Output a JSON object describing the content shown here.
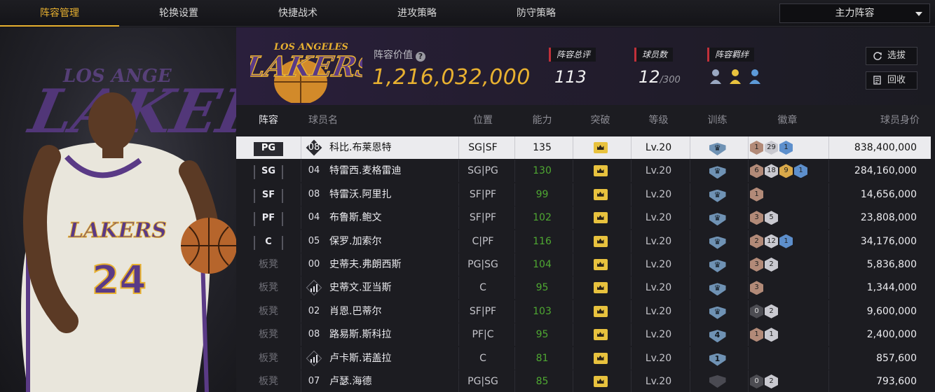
{
  "nav": {
    "tabs": [
      {
        "label": "阵容管理",
        "active": true
      },
      {
        "label": "轮换设置",
        "active": false
      },
      {
        "label": "快捷战术",
        "active": false
      },
      {
        "label": "进攻策略",
        "active": false
      },
      {
        "label": "防守策略",
        "active": false
      }
    ],
    "lineup_selector": "主力阵容"
  },
  "player_card": {
    "team_wordmark": "LAKERS",
    "jersey_team": "LAKERS",
    "jersey_number": "24"
  },
  "header": {
    "team_logo_text": "LAKERS",
    "team_logo_arc": "LOS ANGELES",
    "value_label": "阵容价值",
    "value": "1,216,032,000",
    "stats": [
      {
        "label": "阵容总评",
        "value": "113",
        "suffix": ""
      },
      {
        "label": "球员数",
        "value": "12",
        "suffix": "/300"
      },
      {
        "label": "阵容羁绊",
        "value": "",
        "suffix": ""
      }
    ],
    "buttons": {
      "select": "选拔",
      "recycle": "回收"
    }
  },
  "table": {
    "columns": [
      "阵容",
      "球员名",
      "位置",
      "能力",
      "突破",
      "等级",
      "训练",
      "徽章",
      "球员身价"
    ],
    "rows": [
      {
        "slot": "PG",
        "starter": true,
        "jersey": "08",
        "jersey_style": "diamond-dark",
        "name": "科比.布莱恩特",
        "position": "SG|SF",
        "ability": "135",
        "ability_green": false,
        "level": "Lv.20",
        "training": "",
        "badges": [
          [
            "bronze",
            "1"
          ],
          [
            "silver",
            "29"
          ],
          [
            "blue",
            "1"
          ]
        ],
        "value": "838,400,000"
      },
      {
        "slot": "SG",
        "starter": true,
        "jersey": "04",
        "jersey_style": "plain",
        "name": "特雷西.麦格雷迪",
        "position": "SG|PG",
        "ability": "130",
        "ability_green": true,
        "level": "Lv.20",
        "training": "",
        "badges": [
          [
            "bronze",
            "6"
          ],
          [
            "silver",
            "18"
          ],
          [
            "gold",
            "9"
          ],
          [
            "blue",
            "1"
          ]
        ],
        "value": "284,160,000"
      },
      {
        "slot": "SF",
        "starter": true,
        "jersey": "08",
        "jersey_style": "plain",
        "name": "特雷沃.阿里扎",
        "position": "SF|PF",
        "ability": "99",
        "ability_green": true,
        "level": "Lv.20",
        "training": "",
        "badges": [
          [
            "bronze",
            "1"
          ]
        ],
        "value": "14,656,000"
      },
      {
        "slot": "PF",
        "starter": true,
        "jersey": "04",
        "jersey_style": "plain",
        "name": "布鲁斯.鲍文",
        "position": "SF|PF",
        "ability": "102",
        "ability_green": true,
        "level": "Lv.20",
        "training": "",
        "badges": [
          [
            "bronze",
            "3"
          ],
          [
            "silver",
            "5"
          ]
        ],
        "value": "23,808,000"
      },
      {
        "slot": "C",
        "starter": true,
        "jersey": "05",
        "jersey_style": "plain",
        "name": "保罗.加索尔",
        "position": "C|PF",
        "ability": "116",
        "ability_green": true,
        "level": "Lv.20",
        "training": "",
        "badges": [
          [
            "bronze",
            "2"
          ],
          [
            "silver",
            "12"
          ],
          [
            "blue",
            "1"
          ]
        ],
        "value": "34,176,000"
      },
      {
        "slot": "板凳",
        "starter": false,
        "jersey": "00",
        "jersey_style": "plain",
        "name": "史蒂夫.弗朗西斯",
        "position": "PG|SG",
        "ability": "104",
        "ability_green": true,
        "level": "Lv.20",
        "training": "",
        "badges": [
          [
            "bronze",
            "3"
          ],
          [
            "silver",
            "2"
          ]
        ],
        "value": "5,836,800"
      },
      {
        "slot": "板凳",
        "starter": false,
        "jersey": "",
        "jersey_style": "bars",
        "name": "史蒂文.亚当斯",
        "position": "C",
        "ability": "95",
        "ability_green": true,
        "level": "Lv.20",
        "training": "",
        "badges": [
          [
            "bronze",
            "3"
          ]
        ],
        "value": "1,344,000"
      },
      {
        "slot": "板凳",
        "starter": false,
        "jersey": "02",
        "jersey_style": "plain",
        "name": "肖恩.巴蒂尔",
        "position": "SF|PF",
        "ability": "103",
        "ability_green": true,
        "level": "Lv.20",
        "training": "",
        "badges": [
          [
            "black",
            "0"
          ],
          [
            "silver",
            "2"
          ]
        ],
        "value": "9,600,000"
      },
      {
        "slot": "板凳",
        "starter": false,
        "jersey": "08",
        "jersey_style": "plain",
        "name": "路易斯.斯科拉",
        "position": "PF|C",
        "ability": "95",
        "ability_green": true,
        "level": "Lv.20",
        "training": "4",
        "badges": [
          [
            "bronze",
            "1"
          ],
          [
            "silver",
            "1"
          ]
        ],
        "value": "2,400,000"
      },
      {
        "slot": "板凳",
        "starter": false,
        "jersey": "",
        "jersey_style": "bars",
        "name": "卢卡斯.诺盖拉",
        "position": "C",
        "ability": "81",
        "ability_green": true,
        "level": "Lv.20",
        "training": "1",
        "badges": [],
        "value": "857,600"
      },
      {
        "slot": "板凳",
        "starter": false,
        "jersey": "07",
        "jersey_style": "plain",
        "name": "卢瑟.海德",
        "position": "PG|SG",
        "ability": "85",
        "ability_green": true,
        "level": "Lv.20",
        "training": "dark",
        "badges": [
          [
            "black",
            "0"
          ],
          [
            "silver",
            "2"
          ]
        ],
        "value": "793,600"
      }
    ]
  },
  "colors": {
    "accent": "#e8b130",
    "ability_green": "#4fa832",
    "tag_red": "#c0303a"
  }
}
